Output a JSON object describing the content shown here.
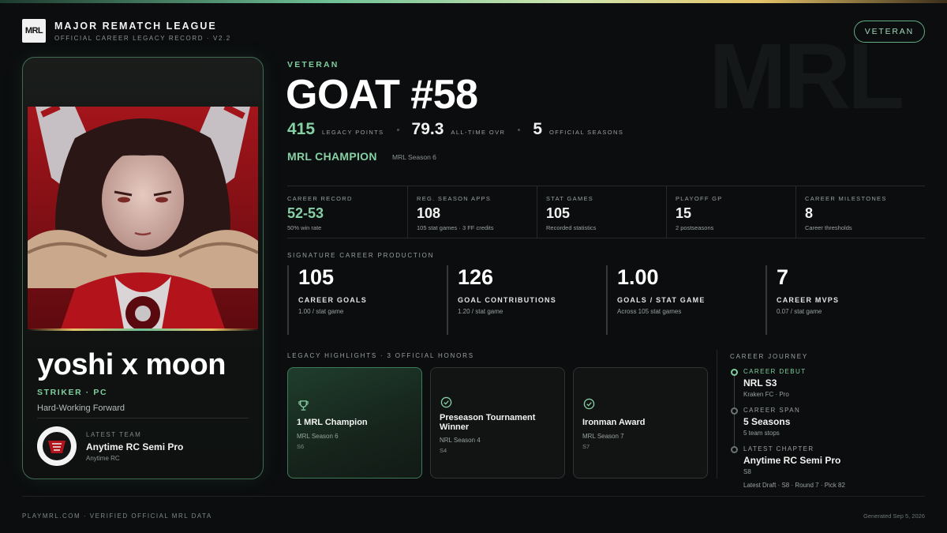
{
  "brand": {
    "logo_text": "MRL",
    "name": "MAJOR REMATCH LEAGUE",
    "subtitle": "OFFICIAL CAREER LEGACY RECORD · V2.2",
    "watermark": "MRL"
  },
  "tier_pill": "VETERAN",
  "player": {
    "name": "yoshi x moon",
    "position": "STRIKER · PC",
    "archetype": "Hard-Working Forward",
    "latest_team_label": "LATEST TEAM",
    "latest_team_name": "Anytime RC Semi Pro",
    "latest_team_org": "Anytime RC"
  },
  "header": {
    "tier_label": "VETERAN",
    "title": "GOAT #58",
    "kpis": [
      {
        "value": "415",
        "label": "LEGACY POINTS"
      },
      {
        "value": "79.3",
        "label": "ALL-TIME OVR"
      },
      {
        "value": "5",
        "label": "OFFICIAL SEASONS"
      }
    ],
    "championship": "MRL CHAMPION",
    "championship_season": "MRL Season 6"
  },
  "summary": [
    {
      "label": "CAREER RECORD",
      "value": "52-53",
      "note": "50% win rate"
    },
    {
      "label": "REG. SEASON APPS",
      "value": "108",
      "note": "105 stat games · 3 FF credits"
    },
    {
      "label": "STAT GAMES",
      "value": "105",
      "note": "Recorded statistics"
    },
    {
      "label": "PLAYOFF GP",
      "value": "15",
      "note": "2 postseasons"
    },
    {
      "label": "CAREER MILESTONES",
      "value": "8",
      "note": "Career thresholds"
    }
  ],
  "production": {
    "label": "SIGNATURE CAREER PRODUCTION",
    "items": [
      {
        "value": "105",
        "label": "CAREER GOALS",
        "note": "1.00 / stat game"
      },
      {
        "value": "126",
        "label": "GOAL CONTRIBUTIONS",
        "note": "1.20 / stat game"
      },
      {
        "value": "1.00",
        "label": "GOALS / STAT GAME",
        "note": "Across 105 stat games"
      },
      {
        "value": "7",
        "label": "CAREER MVPS",
        "note": "0.07 / stat game"
      }
    ]
  },
  "honors": {
    "label": "LEGACY HIGHLIGHTS · 3 OFFICIAL HONORS",
    "items": [
      {
        "name": "1 MRL Champion",
        "season": "MRL Season 6",
        "code": "S6",
        "icon": "trophy-icon"
      },
      {
        "name": "Preseason Tournament Winner",
        "season": "NRL Season 4",
        "code": "S4",
        "icon": "check-circle-icon"
      },
      {
        "name": "Ironman Award",
        "season": "MRL Season 7",
        "code": "S7",
        "icon": "check-circle-icon"
      }
    ]
  },
  "journey": {
    "label": "CAREER JOURNEY",
    "items": [
      {
        "label": "CAREER DEBUT",
        "value": "NRL S3",
        "note": "Kraken FC · Pro"
      },
      {
        "label": "CAREER SPAN",
        "value": "5 Seasons",
        "note": "5 team stops"
      },
      {
        "label": "LATEST CHAPTER",
        "value": "Anytime RC Semi Pro",
        "note": "S8",
        "note2": "Latest Draft · S8 · Round 7 · Pick 82"
      }
    ]
  },
  "footer": {
    "left": "PLAYMRL.COM · VERIFIED OFFICIAL MRL DATA",
    "right": "Generated Sep 5, 2026"
  },
  "colors": {
    "accent_green": "#86d0a6",
    "card_border": "#3f6b53",
    "background": "#0b0d0e"
  }
}
